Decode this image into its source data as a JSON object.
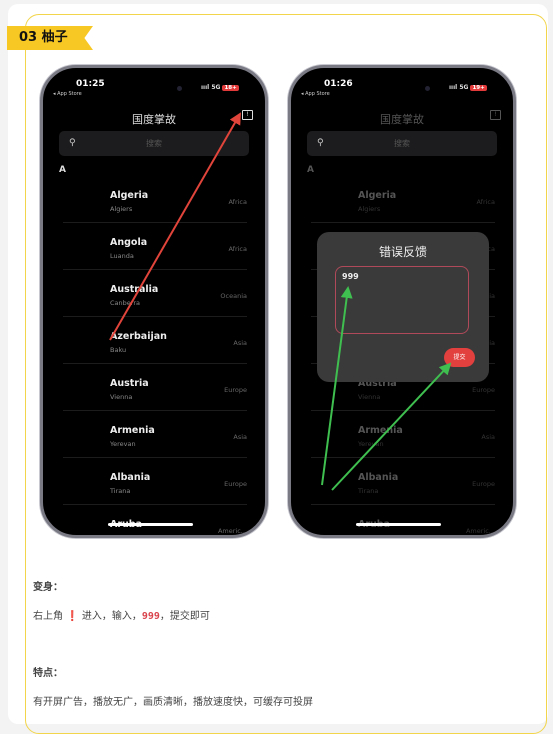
{
  "section_tag": "03 柚子",
  "phones": [
    {
      "time": "01:25",
      "back": "◂ App Store",
      "signal": "5G",
      "battery": "18+",
      "title": "国度掌故",
      "search_placeholder": "搜索",
      "section": "A"
    },
    {
      "time": "01:26",
      "back": "◂ App Store",
      "signal": "5G",
      "battery": "19+",
      "title": "国度掌故",
      "search_placeholder": "搜索",
      "section": "A"
    }
  ],
  "countries": [
    {
      "name": "Algeria",
      "capital": "Algiers",
      "continent": "Africa"
    },
    {
      "name": "Angola",
      "capital": "Luanda",
      "continent": "Africa"
    },
    {
      "name": "Australia",
      "capital": "Canberra",
      "continent": "Oceania"
    },
    {
      "name": "Azerbaijan",
      "capital": "Baku",
      "continent": "Asia"
    },
    {
      "name": "Austria",
      "capital": "Vienna",
      "continent": "Europe"
    },
    {
      "name": "Armenia",
      "capital": "Yerevan",
      "continent": "Asia"
    },
    {
      "name": "Albania",
      "capital": "Tirana",
      "continent": "Europe"
    },
    {
      "name": "Aruba",
      "capital": "",
      "continent": "Americ..."
    }
  ],
  "dialog": {
    "title": "错误反馈",
    "input_value": "999",
    "submit_label": "提交"
  },
  "text": {
    "transform_label": "变身：",
    "instr_prefix": "右上角",
    "instr_mark": "❗",
    "instr_mid": "进入，输入，",
    "instr_code": "999",
    "instr_suffix": "，提交即可",
    "features_label": "特点：",
    "features": "有开屏广告，播放无广，画质清晰，播放速度快，可缓存可投屏"
  },
  "colors": {
    "tag": "#f7c824",
    "border": "#f2d54a",
    "arrow_red": "#e0443a",
    "arrow_green": "#3fbf4f",
    "submit": "#e2403e"
  }
}
